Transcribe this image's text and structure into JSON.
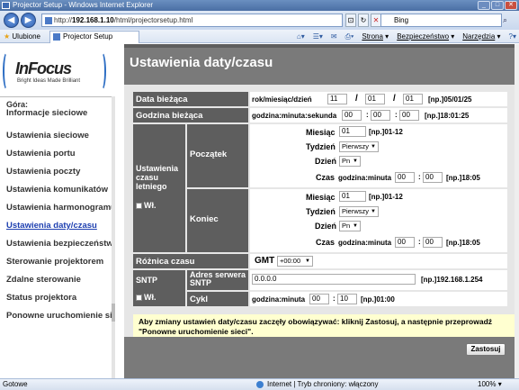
{
  "window": {
    "title": "Projector Setup - Windows Internet Explorer"
  },
  "nav": {
    "address_prefix": "http://",
    "address_domain": "192.168.1.10",
    "address_path": "/html/projectorsetup.html",
    "search_text": "Bing"
  },
  "favbar": {
    "favorites": "Ulubione",
    "tab_title": "Projector Setup",
    "page_menu": "Strona",
    "safety_menu": "Bezpieczeństwo",
    "tools_menu": "Narzędzia"
  },
  "logo": {
    "brand": "InFocus",
    "tagline": "Bright Ideas Made Brilliant"
  },
  "sidebar": {
    "gora": "Góra:",
    "items": [
      {
        "label": "Informacje sieciowe"
      },
      {
        "label": "Ustawienia sieciowe"
      },
      {
        "label": "Ustawienia portu"
      },
      {
        "label": "Ustawienia poczty"
      },
      {
        "label": "Ustawienia komunikatów"
      },
      {
        "label": "Ustawienia harmonogramu"
      },
      {
        "label": "Ustawienia daty/czasu"
      },
      {
        "label": "Ustawienia bezpieczeństwa"
      },
      {
        "label": "Sterowanie projektorem"
      },
      {
        "label": "Zdalne sterowanie"
      },
      {
        "label": "Status projektora"
      },
      {
        "label": "Ponowne uruchomienie sieci"
      }
    ]
  },
  "page": {
    "title": "Ustawienia daty/czasu"
  },
  "form": {
    "current_date": {
      "label": "Data bieżąca",
      "format": "rok/miesiąc/dzień",
      "year": "11",
      "month": "01",
      "day": "01",
      "sep": "/",
      "hint": "[np.]05/01/25"
    },
    "current_time": {
      "label": "Godzina bieżąca",
      "format": "godzina:minuta:sekunda",
      "hour": "00",
      "minute": "00",
      "second": "00",
      "sep": ":",
      "hint": "[np.]18:01:25"
    },
    "dst": {
      "label": "Ustawienia czasu letniego",
      "enable_label": "Wł.",
      "start_label": "Początek",
      "end_label": "Koniec",
      "month_label": "Miesiąc",
      "week_label": "Tydzień",
      "day_label": "Dzień",
      "time_label": "Czas",
      "time_format": "godzina:minuta",
      "month_hint": "[np.]01-12",
      "time_hint": "[np.]18:05",
      "start": {
        "month": "01",
        "week": "Pierwszy",
        "day": "Pn",
        "hour": "00",
        "minute": "00"
      },
      "end": {
        "month": "01",
        "week": "Pierwszy",
        "day": "Pn",
        "hour": "00",
        "minute": "00"
      }
    },
    "timezone": {
      "label": "Różnica czasu",
      "gmt_label": "GMT",
      "value": "+00:00"
    },
    "sntp": {
      "label": "SNTP",
      "enable_label": "Wł.",
      "server_label": "Adres serwera SNTP",
      "server_value": "0.0.0.0",
      "server_hint": "[np.]192.168.1.254",
      "cycle_label": "Cykl",
      "cycle_format": "godzina:minuta",
      "cycle_hour": "00",
      "cycle_minute": "10",
      "cycle_hint": "[np.]01:00"
    },
    "note": "Aby zmiany ustawień daty/czasu zaczęły obowiązywać: kliknij Zastosuj, a następnie przeprowadź \"Ponowne uruchomienie sieci\".",
    "apply_label": "Zastosuj"
  },
  "statusbar": {
    "left": "Gotowe",
    "zone": "Internet | Tryb chroniony: włączony",
    "zoom": "100%"
  }
}
